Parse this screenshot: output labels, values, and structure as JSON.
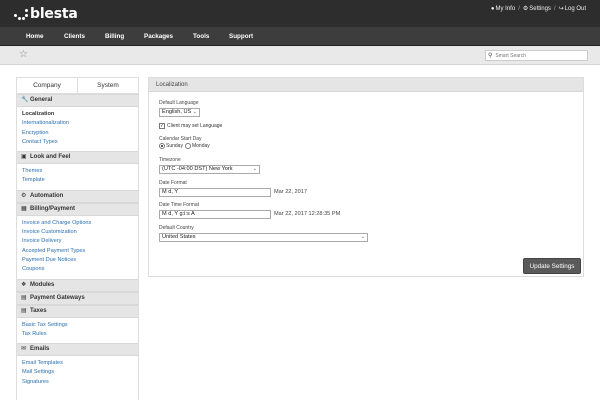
{
  "brand": {
    "logo_text": "blesta"
  },
  "top_links": {
    "my_info": "My Info",
    "settings": "Settings",
    "log_out": "Log Out",
    "separator": "/"
  },
  "nav": [
    {
      "label": "Home"
    },
    {
      "label": "Clients"
    },
    {
      "label": "Billing"
    },
    {
      "label": "Packages"
    },
    {
      "label": "Tools"
    },
    {
      "label": "Support"
    }
  ],
  "search": {
    "placeholder": "Smart Search"
  },
  "sidebar": {
    "tabs": [
      "Company",
      "System"
    ],
    "sections": [
      {
        "title": "General",
        "icon": "wrench-icon",
        "links": [
          "Localization",
          "Internationalization",
          "Encryption",
          "Contact Types"
        ]
      },
      {
        "title": "Look and Feel",
        "icon": "monitor-icon",
        "links": [
          "Themes",
          "Template"
        ]
      },
      {
        "title": "Automation",
        "icon": "gear-icon",
        "links": []
      },
      {
        "title": "Billing/Payment",
        "icon": "money-icon",
        "links": [
          "Invoice and Charge Options",
          "Invoice Customization",
          "Invoice Delivery",
          "Accepted Payment Types",
          "Payment Due Notices",
          "Coupons"
        ]
      },
      {
        "title": "Modules",
        "icon": "puzzle-icon",
        "links": []
      },
      {
        "title": "Payment Gateways",
        "icon": "card-icon",
        "links": []
      },
      {
        "title": "Taxes",
        "icon": "document-icon",
        "links": [
          "Basic Tax Settings",
          "Tax Rules"
        ]
      },
      {
        "title": "Emails",
        "icon": "envelope-icon",
        "links": [
          "Email Templates",
          "Mail Settings",
          "Signatures"
        ]
      }
    ]
  },
  "main": {
    "title": "Localization",
    "default_language_label": "Default Language",
    "default_language_value": "English, US",
    "client_language_label": "Client may set Language",
    "calendar_label": "Calendar Start Day",
    "sunday": "Sunday",
    "monday": "Monday",
    "timezone_label": "Timezone",
    "timezone_value": "(UTC -04:00 DST) New York",
    "date_format_label": "Date Format",
    "date_format_value": "M d, Y",
    "date_format_preview": "Mar 22, 2017",
    "datetime_format_label": "Date Time Format",
    "datetime_format_value": "M d, Y g:i:s A",
    "datetime_format_preview": "Mar 22, 2017 12:28:35 PM",
    "country_label": "Default Country",
    "country_value": "United States",
    "submit": "Update Settings"
  }
}
